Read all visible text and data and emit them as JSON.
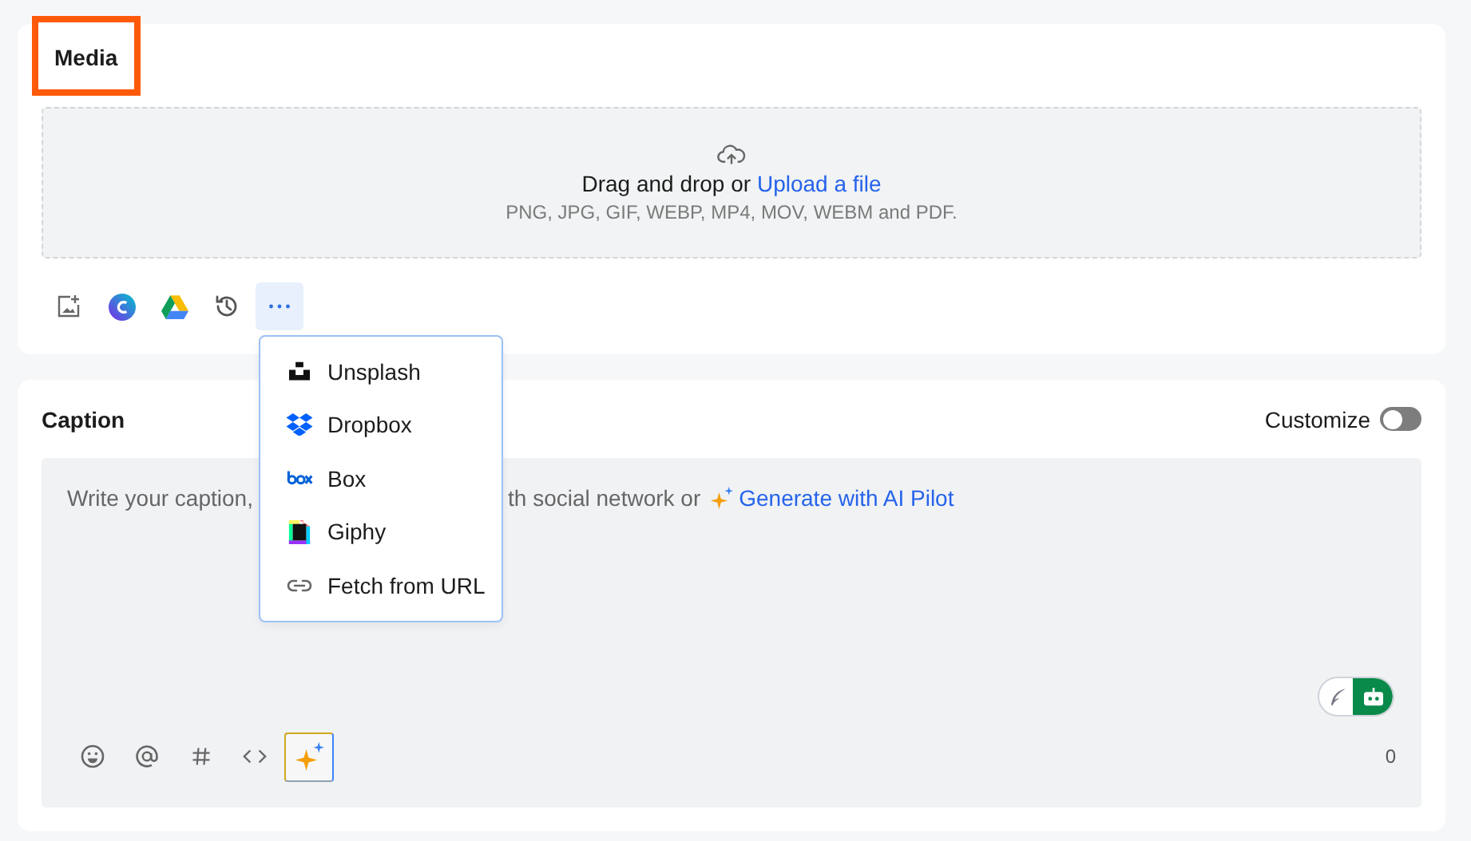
{
  "media": {
    "title": "Media",
    "highlighted": true,
    "dropzone": {
      "text": "Drag and drop or",
      "link": "Upload a file",
      "formats": "PNG, JPG, GIF, WEBP, MP4, MOV, WEBM and PDF."
    },
    "tools": [
      {
        "kind": "image",
        "selected": false
      },
      {
        "kind": "canva",
        "selected": false
      },
      {
        "kind": "drive",
        "selected": false
      },
      {
        "kind": "history",
        "selected": false
      },
      {
        "kind": "more",
        "selected": true
      }
    ],
    "menu": [
      {
        "kind": "unsplash",
        "label": "Unsplash"
      },
      {
        "kind": "dropbox",
        "label": "Dropbox"
      },
      {
        "kind": "box",
        "label": "Box"
      },
      {
        "kind": "giphy",
        "label": "Giphy"
      },
      {
        "kind": "link",
        "label": "Fetch from URL"
      }
    ]
  },
  "caption": {
    "title": "Caption",
    "customize": {
      "label": "Customize",
      "on": false
    },
    "placeholder_start": "Write your caption,",
    "placeholder_end": "th social network or",
    "ai_link": "Generate with AI Pilot",
    "tools": [
      {
        "kind": "emoji",
        "selected": false
      },
      {
        "kind": "mention",
        "selected": false
      },
      {
        "kind": "hashtag",
        "selected": false
      },
      {
        "kind": "code",
        "selected": false
      },
      {
        "kind": "ai",
        "selected": true
      }
    ],
    "writer_mode": {
      "bot_selected": true
    },
    "counter": "0"
  }
}
